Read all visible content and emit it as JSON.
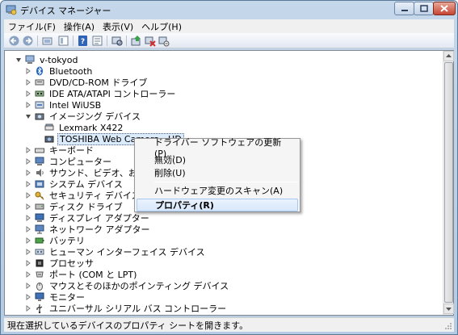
{
  "window": {
    "title": "デバイス マネージャー"
  },
  "menubar": {
    "items": [
      "ファイル(F)",
      "操作(A)",
      "表示(V)",
      "ヘルプ(H)"
    ]
  },
  "toolbar": {
    "icons": [
      "back-icon",
      "forward-icon",
      "up-folder-icon",
      "show-hide-tree-icon",
      "help-icon",
      "properties-icon",
      "scan-icon",
      "update-driver-icon",
      "disable-device-icon",
      "uninstall-device-icon"
    ]
  },
  "tree": {
    "root": "v-tokyod",
    "nodes": [
      {
        "label": "Bluetooth",
        "icon": "bluetooth-icon"
      },
      {
        "label": "DVD/CD-ROM ドライブ",
        "icon": "dvd-drive-icon"
      },
      {
        "label": "IDE ATA/ATAPI コントローラー",
        "icon": "ide-controller-icon"
      },
      {
        "label": "Intel WiUSB",
        "icon": "usb-icon"
      },
      {
        "label": "イメージング デバイス",
        "icon": "camera-icon",
        "expanded": true,
        "children": [
          {
            "label": "Lexmark X422",
            "icon": "scanner-icon"
          },
          {
            "label": "TOSHIBA Web Camera - HD",
            "icon": "webcam-icon",
            "selected": true
          }
        ]
      },
      {
        "label": "キーボード",
        "icon": "keyboard-icon"
      },
      {
        "label": "コンピューター",
        "icon": "computer-icon"
      },
      {
        "label": "サウンド、ビデオ、およびゲ",
        "icon": "sound-icon"
      },
      {
        "label": "システム デバイス",
        "icon": "system-device-icon"
      },
      {
        "label": "セキュリティ デバイス",
        "icon": "security-device-icon"
      },
      {
        "label": "ディスク ドライブ",
        "icon": "disk-drive-icon"
      },
      {
        "label": "ディスプレイ アダプター",
        "icon": "display-adapter-icon"
      },
      {
        "label": "ネットワーク アダプター",
        "icon": "network-adapter-icon"
      },
      {
        "label": "バッテリ",
        "icon": "battery-icon"
      },
      {
        "label": "ヒューマン インターフェイス デバイス",
        "icon": "hid-icon"
      },
      {
        "label": "プロセッサ",
        "icon": "processor-icon"
      },
      {
        "label": "ポート (COM と LPT)",
        "icon": "port-icon"
      },
      {
        "label": "マウスとそのほかのポインティング デバイス",
        "icon": "mouse-icon"
      },
      {
        "label": "モニター",
        "icon": "monitor-icon"
      },
      {
        "label": "ユニバーサル シリアル バス コントローラー",
        "icon": "usb-controller-icon"
      }
    ]
  },
  "context_menu": {
    "items": [
      {
        "label": "ドライバー ソフトウェアの更新(P)...",
        "bold": false
      },
      {
        "label": "無効(D)",
        "bold": false
      },
      {
        "label": "削除(U)",
        "bold": false
      },
      {
        "label": "ハードウェア変更のスキャン(A)",
        "bold": false
      },
      {
        "label": "プロパティ(R)",
        "bold": true,
        "highlighted": true
      }
    ]
  },
  "statusbar": {
    "text": "現在選択しているデバイスのプロパティ シートを開きます。"
  },
  "colors": {
    "title_gradient_top": "#c5d7ea",
    "selection_bg": "#dcebfc",
    "menu_highlight": "#d8e8fc",
    "close_button": "#c64532"
  }
}
